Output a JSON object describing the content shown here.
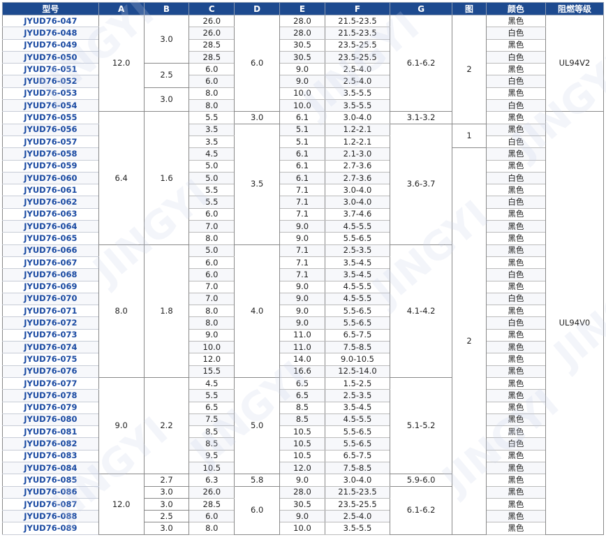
{
  "headers": [
    "型号",
    "A",
    "B",
    "C",
    "D",
    "E",
    "F",
    "G",
    "图",
    "颜色",
    "阻燃等级"
  ],
  "rows": [
    {
      "model": "JYUD76-047",
      "C": "26.0",
      "E": "28.0",
      "F": "21.5-23.5",
      "color": "黑色"
    },
    {
      "model": "JYUD76-048",
      "C": "26.0",
      "E": "28.0",
      "F": "21.5-23.5",
      "color": "白色"
    },
    {
      "model": "JYUD76-049",
      "C": "28.5",
      "E": "30.5",
      "F": "23.5-25.5",
      "color": "黑色"
    },
    {
      "model": "JYUD76-050",
      "C": "28.5",
      "E": "30.5",
      "F": "23.5-25.5",
      "color": "白色"
    },
    {
      "model": "JYUD76-051",
      "C": "6.0",
      "E": "9.0",
      "F": "2.5-4.0",
      "color": "黑色"
    },
    {
      "model": "JYUD76-052",
      "C": "6.0",
      "E": "9.0",
      "F": "2.5-4.0",
      "color": "白色"
    },
    {
      "model": "JYUD76-053",
      "C": "8.0",
      "E": "10.0",
      "F": "3.5-5.5",
      "color": "黑色"
    },
    {
      "model": "JYUD76-054",
      "C": "8.0",
      "E": "10.0",
      "F": "3.5-5.5",
      "color": "白色"
    },
    {
      "model": "JYUD76-055",
      "C": "5.5",
      "E": "6.1",
      "F": "3.0-4.0",
      "color": "黑色"
    },
    {
      "model": "JYUD76-056",
      "C": "3.5",
      "E": "5.1",
      "F": "1.2-2.1",
      "color": "黑色"
    },
    {
      "model": "JYUD76-057",
      "C": "3.5",
      "E": "5.1",
      "F": "1.2-2.1",
      "color": "白色"
    },
    {
      "model": "JYUD76-058",
      "C": "4.5",
      "E": "6.1",
      "F": "2.1-3.0",
      "color": "黑色"
    },
    {
      "model": "JYUD76-059",
      "C": "5.0",
      "E": "6.1",
      "F": "2.7-3.6",
      "color": "黑色"
    },
    {
      "model": "JYUD76-060",
      "C": "5.0",
      "E": "6.1",
      "F": "2.7-3.6",
      "color": "白色"
    },
    {
      "model": "JYUD76-061",
      "C": "5.5",
      "E": "7.1",
      "F": "3.0-4.0",
      "color": "黑色"
    },
    {
      "model": "JYUD76-062",
      "C": "5.5",
      "E": "7.1",
      "F": "3.0-4.0",
      "color": "白色"
    },
    {
      "model": "JYUD76-063",
      "C": "6.0",
      "E": "7.1",
      "F": "3.7-4.6",
      "color": "黑色"
    },
    {
      "model": "JYUD76-064",
      "C": "7.0",
      "E": "9.0",
      "F": "4.5-5.5",
      "color": "黑色"
    },
    {
      "model": "JYUD76-065",
      "C": "8.0",
      "E": "9.0",
      "F": "5.5-6.5",
      "color": "黑色"
    },
    {
      "model": "JYUD76-066",
      "C": "5.0",
      "E": "7.1",
      "F": "2.5-3.5",
      "color": "黑色"
    },
    {
      "model": "JYUD76-067",
      "C": "6.0",
      "E": "7.1",
      "F": "3.5-4.5",
      "color": "黑色"
    },
    {
      "model": "JYUD76-068",
      "C": "6.0",
      "E": "7.1",
      "F": "3.5-4.5",
      "color": "白色"
    },
    {
      "model": "JYUD76-069",
      "C": "7.0",
      "E": "9.0",
      "F": "4.5-5.5",
      "color": "黑色"
    },
    {
      "model": "JYUD76-070",
      "C": "7.0",
      "E": "9.0",
      "F": "4.5-5.5",
      "color": "白色"
    },
    {
      "model": "JYUD76-071",
      "C": "8.0",
      "E": "9.0",
      "F": "5.5-6.5",
      "color": "黑色"
    },
    {
      "model": "JYUD76-072",
      "C": "8.0",
      "E": "9.0",
      "F": "5.5-6.5",
      "color": "白色"
    },
    {
      "model": "JYUD76-073",
      "C": "9.0",
      "E": "11.0",
      "F": "6.5-7.5",
      "color": "黑色"
    },
    {
      "model": "JYUD76-074",
      "C": "10.0",
      "E": "11.0",
      "F": "7.5-8.5",
      "color": "黑色"
    },
    {
      "model": "JYUD76-075",
      "C": "12.0",
      "E": "14.0",
      "F": "9.0-10.5",
      "color": "黑色"
    },
    {
      "model": "JYUD76-076",
      "C": "15.5",
      "E": "16.6",
      "F": "12.5-14.0",
      "color": "黑色"
    },
    {
      "model": "JYUD76-077",
      "C": "4.5",
      "E": "6.5",
      "F": "1.5-2.5",
      "color": "黑色"
    },
    {
      "model": "JYUD76-078",
      "C": "5.5",
      "E": "6.5",
      "F": "2.5-3.5",
      "color": "黑色"
    },
    {
      "model": "JYUD76-079",
      "C": "6.5",
      "E": "8.5",
      "F": "3.5-4.5",
      "color": "黑色"
    },
    {
      "model": "JYUD76-080",
      "C": "7.5",
      "E": "8.5",
      "F": "4.5-5.5",
      "color": "黑色"
    },
    {
      "model": "JYUD76-081",
      "C": "8.5",
      "E": "10.5",
      "F": "5.5-6.5",
      "color": "黑色"
    },
    {
      "model": "JYUD76-082",
      "C": "8.5",
      "E": "10.5",
      "F": "5.5-6.5",
      "color": "白色"
    },
    {
      "model": "JYUD76-083",
      "C": "9.5",
      "E": "10.5",
      "F": "6.5-7.5",
      "color": "黑色"
    },
    {
      "model": "JYUD76-084",
      "C": "10.5",
      "E": "12.0",
      "F": "7.5-8.5",
      "color": "黑色"
    },
    {
      "model": "JYUD76-085",
      "C": "6.3",
      "E": "9.0",
      "F": "3.0-4.0",
      "color": "黑色"
    },
    {
      "model": "JYUD76-086",
      "C": "26.0",
      "E": "28.0",
      "F": "21.5-23.5",
      "color": "黑色"
    },
    {
      "model": "JYUD76-087",
      "C": "28.5",
      "E": "30.5",
      "F": "23.5-25.5",
      "color": "黑色"
    },
    {
      "model": "JYUD76-088",
      "C": "6.0",
      "E": "9.0",
      "F": "2.5-4.0",
      "color": "黑色"
    },
    {
      "model": "JYUD76-089",
      "C": "8.0",
      "E": "10.0",
      "F": "3.5-5.5",
      "color": "黑色"
    }
  ],
  "merged": {
    "A": [
      {
        "start": 0,
        "span": 8,
        "value": "12.0"
      },
      {
        "start": 8,
        "span": 11,
        "value": "6.4"
      },
      {
        "start": 19,
        "span": 11,
        "value": "8.0"
      },
      {
        "start": 30,
        "span": 8,
        "value": "9.0"
      },
      {
        "start": 38,
        "span": 5,
        "value": "12.0"
      }
    ],
    "B": [
      {
        "start": 0,
        "span": 4,
        "value": "3.0"
      },
      {
        "start": 4,
        "span": 2,
        "value": "2.5"
      },
      {
        "start": 6,
        "span": 2,
        "value": "3.0"
      },
      {
        "start": 8,
        "span": 11,
        "value": "1.6"
      },
      {
        "start": 19,
        "span": 11,
        "value": "1.8"
      },
      {
        "start": 30,
        "span": 8,
        "value": "2.2"
      },
      {
        "start": 38,
        "span": 1,
        "value": "2.7"
      },
      {
        "start": 39,
        "span": 1,
        "value": "3.0"
      },
      {
        "start": 40,
        "span": 1,
        "value": "3.0"
      },
      {
        "start": 41,
        "span": 1,
        "value": "2.5"
      },
      {
        "start": 42,
        "span": 1,
        "value": "3.0"
      }
    ],
    "D": [
      {
        "start": 0,
        "span": 8,
        "value": "6.0"
      },
      {
        "start": 8,
        "span": 1,
        "value": "3.0"
      },
      {
        "start": 9,
        "span": 10,
        "value": "3.5"
      },
      {
        "start": 19,
        "span": 11,
        "value": "4.0"
      },
      {
        "start": 30,
        "span": 8,
        "value": "5.0"
      },
      {
        "start": 38,
        "span": 1,
        "value": "5.8"
      },
      {
        "start": 39,
        "span": 4,
        "value": "6.0"
      }
    ],
    "G": [
      {
        "start": 0,
        "span": 8,
        "value": "6.1-6.2"
      },
      {
        "start": 8,
        "span": 1,
        "value": "3.1-3.2"
      },
      {
        "start": 9,
        "span": 10,
        "value": "3.6-3.7"
      },
      {
        "start": 19,
        "span": 11,
        "value": "4.1-4.2"
      },
      {
        "start": 30,
        "span": 8,
        "value": "5.1-5.2"
      },
      {
        "start": 38,
        "span": 1,
        "value": "5.9-6.0"
      },
      {
        "start": 39,
        "span": 4,
        "value": "6.1-6.2"
      }
    ],
    "fig": [
      {
        "start": 0,
        "span": 9,
        "value": "2"
      },
      {
        "start": 9,
        "span": 2,
        "value": "1"
      },
      {
        "start": 11,
        "span": 32,
        "value": "2"
      }
    ],
    "flame": [
      {
        "start": 0,
        "span": 8,
        "value": "UL94V2"
      },
      {
        "start": 8,
        "span": 35,
        "value": "UL94V0"
      }
    ]
  },
  "watermark": "JINGYI"
}
